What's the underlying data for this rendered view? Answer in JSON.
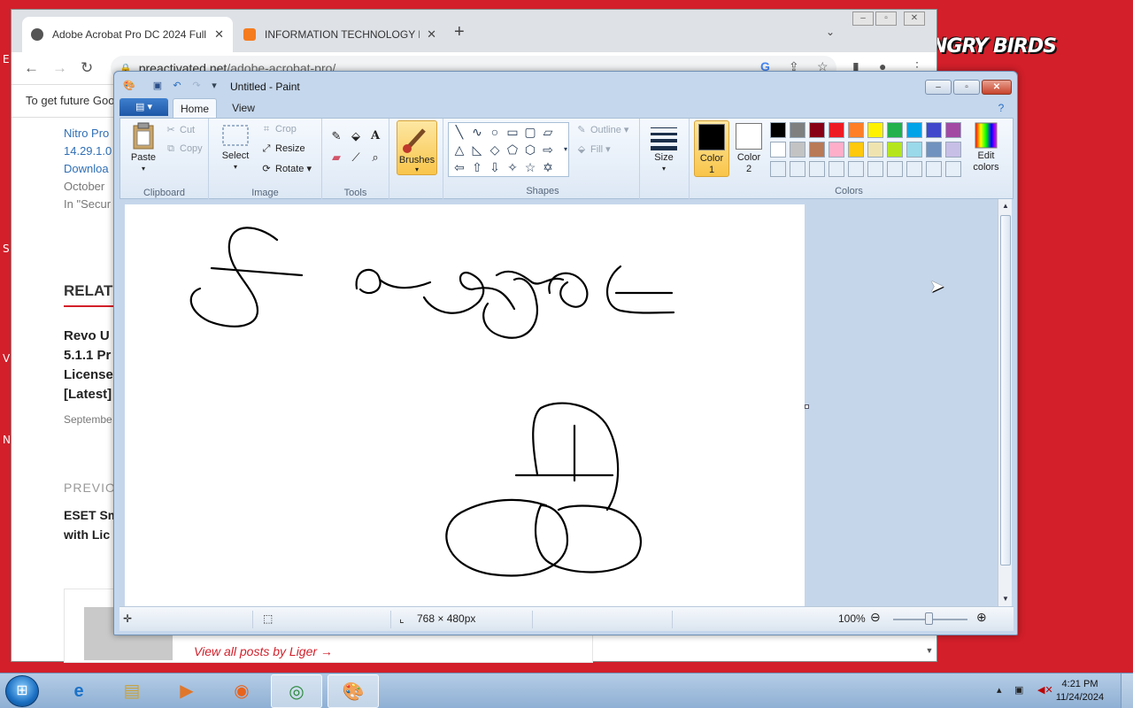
{
  "desktop": {
    "logo_text": "NGRY BIRDS",
    "side_letters": [
      "E",
      "S",
      "V",
      "N"
    ]
  },
  "browser": {
    "tabs": [
      {
        "title": "Adobe Acrobat Pro DC 2024 Full",
        "active": true
      },
      {
        "title": "INFORMATION TECHNOLOGY EX",
        "active": false
      }
    ],
    "new_tab": "+",
    "url_host": "preactivated.net",
    "url_path": "/adobe-acrobat-pro/",
    "infobar_text": "To get future Goo",
    "page": {
      "nitro_lines": [
        "Nitro Pro",
        "14.29.1.0",
        "Downloa"
      ],
      "date_text": "October",
      "category_text": "In \"Secur",
      "related_heading": "RELAT",
      "revo_lines": [
        "Revo U",
        "5.1.1 Pr",
        "License",
        "[Latest]"
      ],
      "revo_date": "Septembe",
      "previous_label": "PREVIO",
      "eset_lines": [
        "ESET Sm",
        "with Lic"
      ],
      "all_posts_link": "View all posts by Liger →"
    }
  },
  "paint": {
    "title": "Untitled - Paint",
    "tabs": [
      "Home",
      "View"
    ],
    "clipboard": {
      "paste": "Paste",
      "cut": "Cut",
      "copy": "Copy",
      "label": "Clipboard"
    },
    "image": {
      "select": "Select",
      "crop": "Crop",
      "resize": "Resize",
      "rotate": "Rotate",
      "label": "Image"
    },
    "tools_label": "Tools",
    "brushes": "Brushes",
    "shapes": {
      "outline": "Outline",
      "fill": "Fill",
      "label": "Shapes"
    },
    "size": "Size",
    "color1_label": "Color\n1",
    "color1_value": "#000000",
    "color2_label": "Color\n2",
    "color2_value": "#ffffff",
    "edit_colors": "Edit\ncolors",
    "colors_label": "Colors",
    "palette_row1": [
      "#000000",
      "#7f7f7f",
      "#880015",
      "#ed1c24",
      "#ff7f27",
      "#fff200",
      "#22b14c",
      "#00a2e8",
      "#3f48cc",
      "#a349a4"
    ],
    "palette_row2": [
      "#ffffff",
      "#c3c3c3",
      "#b97a57",
      "#ffaec9",
      "#ffc90e",
      "#efe4b0",
      "#b5e61d",
      "#99d9ea",
      "#7092be",
      "#c8bfe7"
    ],
    "status": {
      "dimensions": "768 × 480px",
      "zoom": "100%"
    }
  },
  "taskbar": {
    "time": "4:21 PM",
    "date": "11/24/2024"
  }
}
